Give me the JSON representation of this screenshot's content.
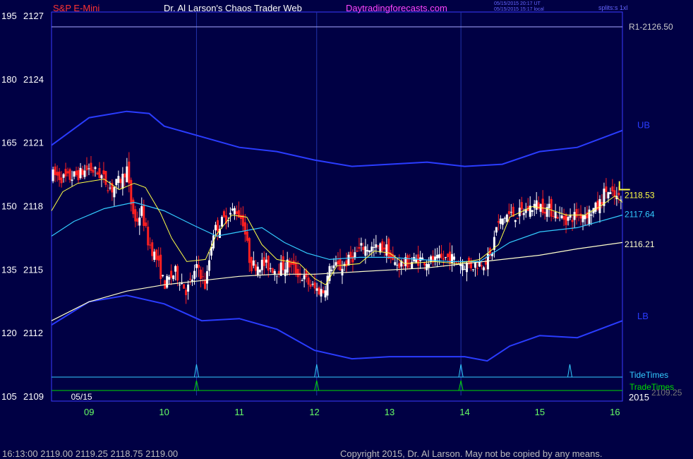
{
  "header": {
    "symbol": "S&P E-Mini",
    "site_title": "Dr. Al Larson's Chaos Trader Web",
    "link": "Daytradingforecasts.com",
    "time_utc": "05/15/2015 20:17 UT",
    "time_local": "05/15/2015 15:17 local",
    "splits": "splits:s 1xl"
  },
  "footer": {
    "quote": "16:13:00  2119.00 2119.25 2118.75 2119.00",
    "copyright": "Copyright 2015, Dr. Al Larson. May not be copied by any means."
  },
  "colors": {
    "background": "#000044",
    "up_bar": "#ffffff",
    "down_bar": "#ff2020",
    "bands": "#2a3cff",
    "fast_ma": "#ffff44",
    "mid_ma": "#33ccff",
    "slow_ma": "#ffffcc",
    "tide": "#33ccff",
    "trade": "#00dd00"
  },
  "chart_data": {
    "type": "candlestick",
    "date_label": "05/15",
    "year_label": "2015",
    "ylim": [
      2108.8,
      2127.2
    ],
    "xlim": [
      8.5,
      16.1
    ],
    "y_ticks": [
      {
        "left": "195",
        "right": "2127",
        "value": 2127
      },
      {
        "left": "180",
        "right": "2124",
        "value": 2124
      },
      {
        "left": "165",
        "right": "2121",
        "value": 2121
      },
      {
        "left": "150",
        "right": "2118",
        "value": 2118
      },
      {
        "left": "135",
        "right": "2115",
        "value": 2115
      },
      {
        "left": "120",
        "right": "2112",
        "value": 2112
      },
      {
        "left": "105",
        "right": "2109",
        "value": 2109
      }
    ],
    "x_ticks": [
      {
        "label": "09",
        "value": 9
      },
      {
        "label": "10",
        "value": 10
      },
      {
        "label": "11",
        "value": 11
      },
      {
        "label": "12",
        "value": 12
      },
      {
        "label": "13",
        "value": 13
      },
      {
        "label": "14",
        "value": 14
      },
      {
        "label": "15",
        "value": 15
      },
      {
        "label": "16",
        "value": 16
      }
    ],
    "resistance": {
      "label": "R1-2126.50",
      "value": 2126.5
    },
    "levels": [
      {
        "label": "2118.53",
        "value": 2118.53,
        "color": "#ffff44"
      },
      {
        "label": "2117.64",
        "value": 2117.64,
        "color": "#33ccff"
      },
      {
        "label": "2116.21",
        "value": 2116.21,
        "color": "#ffffcc"
      }
    ],
    "band_labels": {
      "upper": "UB",
      "lower": "LB"
    },
    "lower_label": "2109.25",
    "tide_label": "TideTimes",
    "trade_label": "TradeTimes",
    "tide_times": [
      10.43,
      12.03,
      13.95,
      15.4
    ],
    "trade_times": [
      10.43,
      12.03,
      13.95
    ],
    "upper_band": [
      [
        8.5,
        2120.9
      ],
      [
        9.0,
        2122.2
      ],
      [
        9.5,
        2122.5
      ],
      [
        9.8,
        2122.4
      ],
      [
        10.0,
        2121.8
      ],
      [
        10.5,
        2121.3
      ],
      [
        11.0,
        2120.8
      ],
      [
        11.5,
        2120.6
      ],
      [
        12.0,
        2120.2
      ],
      [
        12.5,
        2119.9
      ],
      [
        13.0,
        2120.0
      ],
      [
        13.5,
        2120.1
      ],
      [
        14.0,
        2119.9
      ],
      [
        14.5,
        2120.0
      ],
      [
        15.0,
        2120.6
      ],
      [
        15.5,
        2120.8
      ],
      [
        16.1,
        2121.6
      ]
    ],
    "lower_band": [
      [
        8.5,
        2112.4
      ],
      [
        9.0,
        2113.5
      ],
      [
        9.5,
        2113.8
      ],
      [
        10.0,
        2113.4
      ],
      [
        10.5,
        2112.6
      ],
      [
        11.0,
        2112.7
      ],
      [
        11.5,
        2112.2
      ],
      [
        12.0,
        2111.2
      ],
      [
        12.5,
        2110.8
      ],
      [
        13.0,
        2110.9
      ],
      [
        13.5,
        2110.9
      ],
      [
        14.0,
        2110.9
      ],
      [
        14.3,
        2110.7
      ],
      [
        14.6,
        2111.4
      ],
      [
        15.0,
        2111.9
      ],
      [
        15.5,
        2111.8
      ],
      [
        16.1,
        2112.6
      ]
    ],
    "fast_ma": [
      [
        8.5,
        2117.8
      ],
      [
        8.65,
        2118.7
      ],
      [
        8.85,
        2119.1
      ],
      [
        9.2,
        2119.3
      ],
      [
        9.4,
        2118.8
      ],
      [
        9.6,
        2119.1
      ],
      [
        9.75,
        2118.9
      ],
      [
        9.95,
        2117.7
      ],
      [
        10.1,
        2116.5
      ],
      [
        10.3,
        2115.4
      ],
      [
        10.55,
        2115.5
      ],
      [
        10.7,
        2116.7
      ],
      [
        10.9,
        2117.6
      ],
      [
        11.1,
        2117.5
      ],
      [
        11.3,
        2116.2
      ],
      [
        11.5,
        2115.5
      ],
      [
        11.8,
        2115.3
      ],
      [
        12.0,
        2114.6
      ],
      [
        12.15,
        2114.3
      ],
      [
        12.3,
        2115.2
      ],
      [
        12.6,
        2115.3
      ],
      [
        12.8,
        2115.9
      ],
      [
        13.0,
        2115.8
      ],
      [
        13.2,
        2115.3
      ],
      [
        13.6,
        2115.4
      ],
      [
        13.9,
        2115.3
      ],
      [
        14.2,
        2115.5
      ],
      [
        14.45,
        2116.2
      ],
      [
        14.6,
        2117.5
      ],
      [
        14.9,
        2118.0
      ],
      [
        15.1,
        2117.9
      ],
      [
        15.35,
        2117.6
      ],
      [
        15.6,
        2117.6
      ],
      [
        15.8,
        2118.0
      ],
      [
        16.0,
        2118.5
      ],
      [
        16.1,
        2118.2
      ]
    ],
    "mid_ma": [
      [
        8.5,
        2116.6
      ],
      [
        8.8,
        2117.3
      ],
      [
        9.2,
        2117.9
      ],
      [
        9.6,
        2118.2
      ],
      [
        10.0,
        2117.8
      ],
      [
        10.4,
        2117.1
      ],
      [
        10.7,
        2116.6
      ],
      [
        11.0,
        2116.8
      ],
      [
        11.3,
        2117.0
      ],
      [
        11.6,
        2116.3
      ],
      [
        11.9,
        2115.8
      ],
      [
        12.2,
        2115.5
      ],
      [
        12.6,
        2115.6
      ],
      [
        13.0,
        2115.6
      ],
      [
        13.4,
        2115.5
      ],
      [
        13.8,
        2115.4
      ],
      [
        14.2,
        2115.4
      ],
      [
        14.6,
        2116.3
      ],
      [
        15.0,
        2116.8
      ],
      [
        15.5,
        2117.0
      ],
      [
        16.1,
        2117.6
      ]
    ],
    "slow_ma": [
      [
        8.5,
        2112.6
      ],
      [
        9.0,
        2113.5
      ],
      [
        9.5,
        2114.0
      ],
      [
        10.0,
        2114.3
      ],
      [
        10.5,
        2114.5
      ],
      [
        11.0,
        2114.7
      ],
      [
        11.5,
        2114.8
      ],
      [
        12.0,
        2114.8
      ],
      [
        12.5,
        2114.9
      ],
      [
        13.0,
        2115.0
      ],
      [
        13.5,
        2115.1
      ],
      [
        14.0,
        2115.3
      ],
      [
        14.5,
        2115.5
      ],
      [
        15.0,
        2115.7
      ],
      [
        15.5,
        2116.0
      ],
      [
        16.1,
        2116.3
      ]
    ],
    "price_path": [
      [
        8.52,
        2119.5
      ],
      [
        8.7,
        2119.3
      ],
      [
        8.85,
        2119.5
      ],
      [
        9.0,
        2119.8
      ],
      [
        9.15,
        2119.5
      ],
      [
        9.3,
        2118.8
      ],
      [
        9.45,
        2119.4
      ],
      [
        9.5,
        2119.9
      ],
      [
        9.55,
        2118.3
      ],
      [
        9.62,
        2117.2
      ],
      [
        9.7,
        2117.8
      ],
      [
        9.78,
        2116.4
      ],
      [
        9.9,
        2115.5
      ],
      [
        10.0,
        2114.3
      ],
      [
        10.15,
        2114.9
      ],
      [
        10.3,
        2114.0
      ],
      [
        10.45,
        2115.2
      ],
      [
        10.55,
        2114.2
      ],
      [
        10.65,
        2116.8
      ],
      [
        10.8,
        2117.4
      ],
      [
        10.95,
        2117.9
      ],
      [
        11.05,
        2117.3
      ],
      [
        11.15,
        2115.2
      ],
      [
        11.3,
        2115.3
      ],
      [
        11.5,
        2115.0
      ],
      [
        11.65,
        2115.3
      ],
      [
        11.8,
        2114.8
      ],
      [
        12.0,
        2114.1
      ],
      [
        12.12,
        2114.0
      ],
      [
        12.22,
        2115.2
      ],
      [
        12.35,
        2115.1
      ],
      [
        12.5,
        2115.6
      ],
      [
        12.65,
        2116.1
      ],
      [
        12.8,
        2116.0
      ],
      [
        12.95,
        2116.1
      ],
      [
        13.05,
        2115.3
      ],
      [
        13.2,
        2115.3
      ],
      [
        13.4,
        2115.5
      ],
      [
        13.6,
        2115.4
      ],
      [
        13.8,
        2115.6
      ],
      [
        13.95,
        2115.3
      ],
      [
        14.1,
        2115.2
      ],
      [
        14.25,
        2115.4
      ],
      [
        14.35,
        2115.6
      ],
      [
        14.42,
        2117.0
      ],
      [
        14.55,
        2117.6
      ],
      [
        14.7,
        2117.6
      ],
      [
        14.85,
        2117.9
      ],
      [
        14.95,
        2118.1
      ],
      [
        15.1,
        2117.9
      ],
      [
        15.25,
        2117.6
      ],
      [
        15.35,
        2117.4
      ],
      [
        15.5,
        2117.6
      ],
      [
        15.65,
        2117.7
      ],
      [
        15.78,
        2118.0
      ],
      [
        15.88,
        2118.8
      ],
      [
        15.95,
        2118.5
      ],
      [
        16.02,
        2118.4
      ],
      [
        16.08,
        2118.3
      ]
    ]
  }
}
